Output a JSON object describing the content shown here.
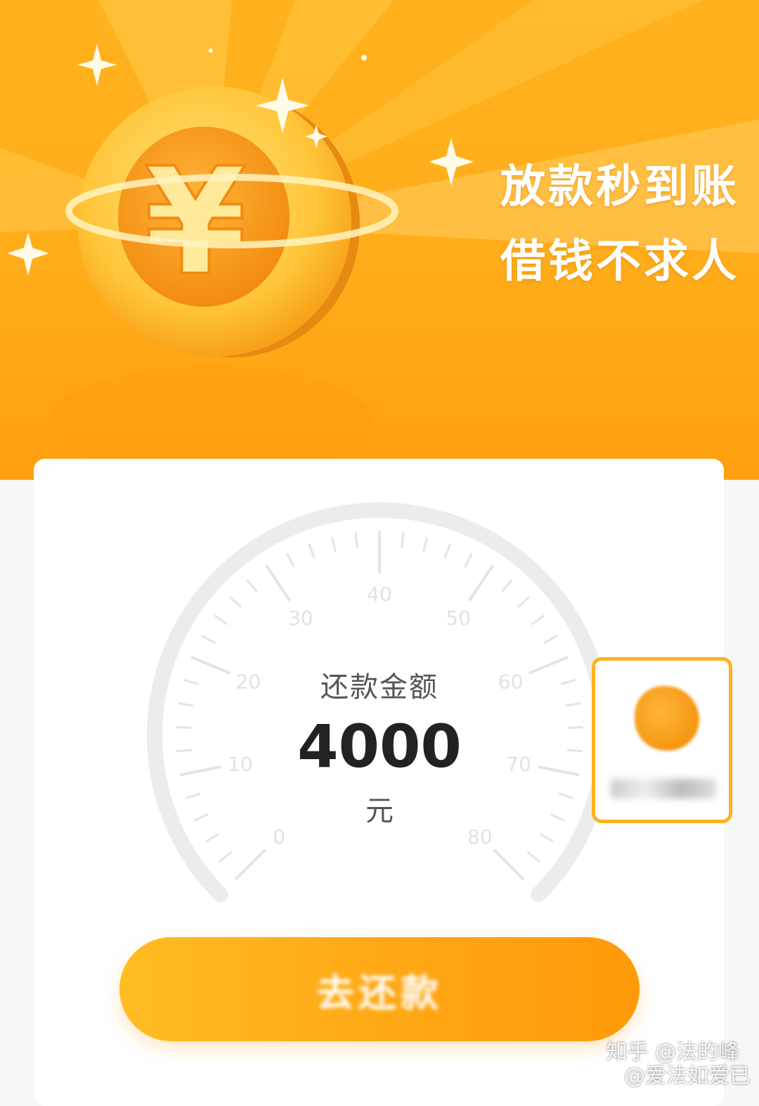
{
  "banner": {
    "slogan_line1": "放款秒到账",
    "slogan_line2": "借钱不求人",
    "coin_symbol": "¥",
    "colors": {
      "orange": "#ffad1a",
      "coin": "#ffc83a"
    }
  },
  "gauge": {
    "title": "还款金额",
    "amount": "4000",
    "unit": "元",
    "tick_labels": [
      "0",
      "10",
      "20",
      "30",
      "40",
      "50",
      "60",
      "70",
      "80"
    ]
  },
  "floating_badge": {
    "icon": "mascot-icon"
  },
  "cta": {
    "label": "去还款"
  },
  "watermark": {
    "line1": "知乎 @法的峰",
    "line2": "@爱法如爱已"
  }
}
